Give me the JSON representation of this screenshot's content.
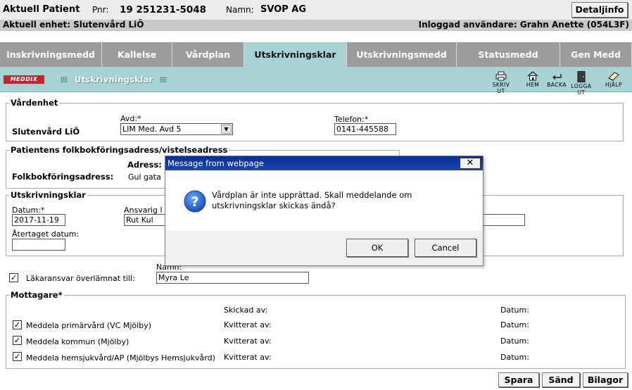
{
  "patient_bar": {
    "title": "Aktuell Patient",
    "pnr_label": "Pnr:",
    "pnr_value": "19 251231-5048",
    "name_label": "Namn:",
    "name_value": "SVOP AG",
    "detail_button": "Detaljinfo"
  },
  "unit_bar": {
    "unit": "Aktuell enhet: Slutenvård LiÖ",
    "user": "Inloggad användare: Grahn Anette (054L3F)"
  },
  "tabs": [
    {
      "label": "Inskrivningsmedd",
      "active": false
    },
    {
      "label": "Kallelse",
      "active": false
    },
    {
      "label": "Vårdplan",
      "active": false
    },
    {
      "label": "Utskrivningsklar",
      "active": true
    },
    {
      "label": "Utskrivningsmedd",
      "active": false
    },
    {
      "label": "Statusmedd",
      "active": false
    },
    {
      "label": "Gen Medd",
      "active": false
    }
  ],
  "toolbar": {
    "logo": "MEDDIX",
    "title": "Utskrivningsklar",
    "tools": [
      {
        "label": "SKRIV UT",
        "icon": "printer-icon"
      },
      {
        "label": "HEM",
        "icon": "home-icon"
      },
      {
        "label": "BACKA",
        "icon": "back-arrow-icon"
      },
      {
        "label": "LOGGA UT",
        "icon": "logout-door-icon"
      },
      {
        "label": "HJÄLP",
        "icon": "help-book-icon"
      }
    ]
  },
  "vardenhet": {
    "legend": "Vårdenhet",
    "unit_name": "Slutenvård LiÖ",
    "avd_label": "Avd:*",
    "avd_value": "LIM Med. Avd 5",
    "telefon_label": "Telefon:*",
    "telefon_value": "0141-445588"
  },
  "address": {
    "legend": "Patientens folkbokföringsadress/vistelseadress",
    "folk_label": "Folkbokföringsadress:",
    "adress_label": "Adress:",
    "adress_value": "Gul gata"
  },
  "utskrivningsklar": {
    "legend": "Utskrivningsklar",
    "datum_label": "Datum:*",
    "datum_value": "2017-11-19",
    "ansvarig_label": "Ansvarig l",
    "ansvarig_value": "Rut Kul",
    "atertaget_label": "Återtaget datum:",
    "atertaget_value": ""
  },
  "lakaransvar": {
    "checked": true,
    "label": "Läkaransvar överlämnat till:",
    "namn_label": "Namn:",
    "namn_value": "Myra Le"
  },
  "mottagare": {
    "legend": "Mottagare*",
    "skickad_label": "Skickad av:",
    "datum_label": "Datum:",
    "rows": [
      {
        "label": "Meddela primärvård (VC Mjölby)",
        "checked": true,
        "kvitterat": "Kvitterat av:",
        "datum": "Datum:"
      },
      {
        "label": "Meddela kommun (Mjölby)",
        "checked": true,
        "kvitterat": "Kvitterat av:",
        "datum": "Datum:"
      },
      {
        "label": "Meddela hemsjukvård/AP (Mjölbys Hemsjukvård)",
        "checked": true,
        "kvitterat": "Kvitterat av:",
        "datum": "Datum:"
      }
    ]
  },
  "actions": {
    "save": "Spara",
    "send": "Sänd",
    "attachments": "Bilagor"
  },
  "dialog": {
    "title": "Message from webpage",
    "message": "Vårdplan är inte upprättad. Skall meddelande om utskrivningsklar skickas ändå?",
    "ok": "OK",
    "cancel": "Cancel",
    "icon": "question-icon"
  }
}
